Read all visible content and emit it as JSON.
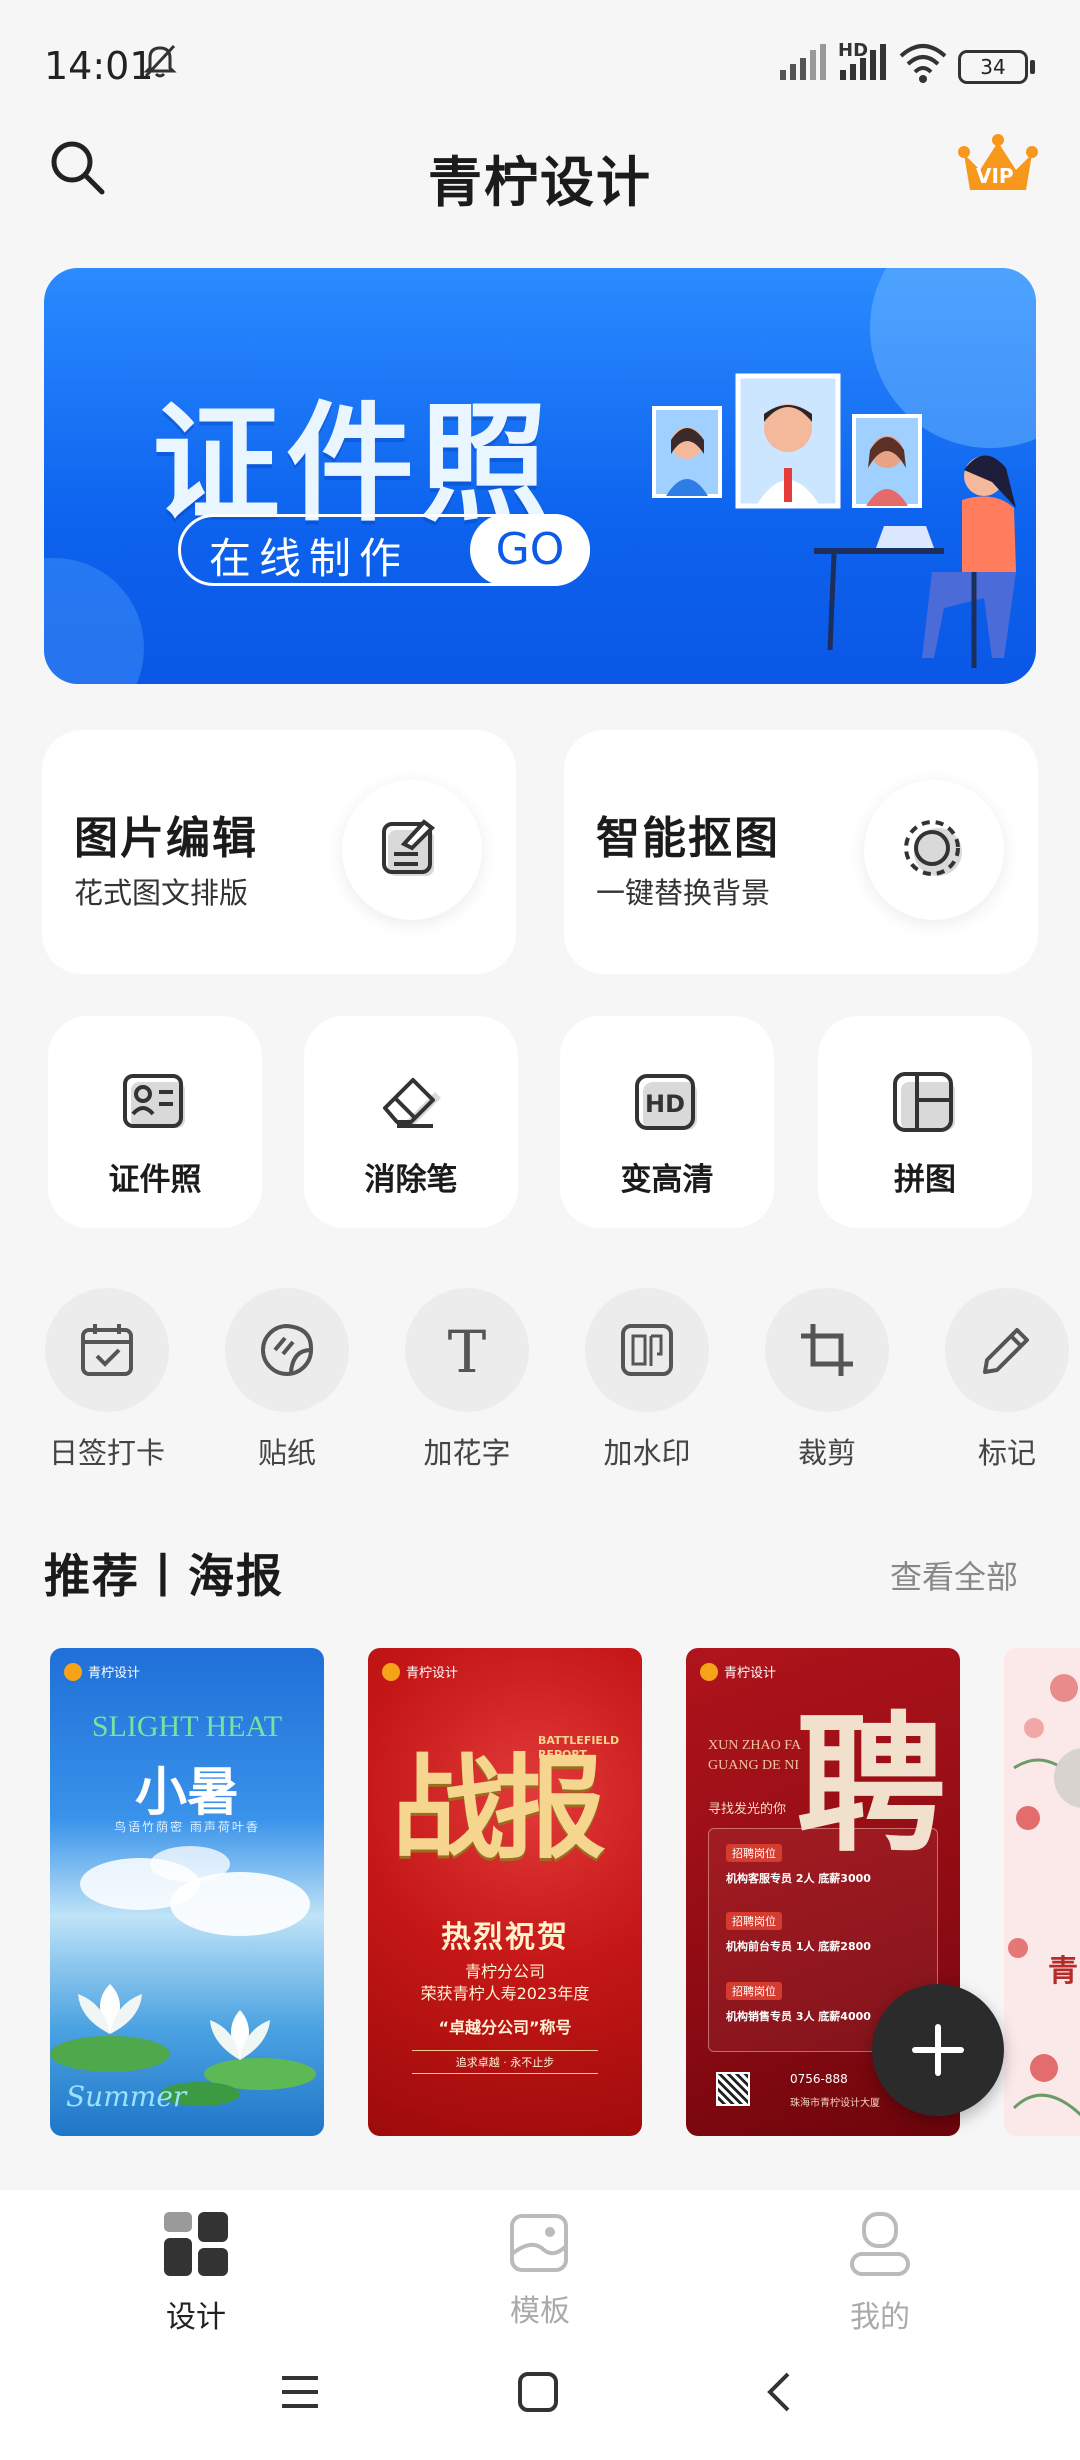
{
  "status_bar": {
    "time": "14:01",
    "mute_icon": "bell-off-icon",
    "signal_label": "HD",
    "battery": "34"
  },
  "header": {
    "title": "青柠设计",
    "search_icon": "search-icon",
    "vip_label": "VIP"
  },
  "banner": {
    "title": "证件照",
    "pill_text": "在线制作",
    "go_label": "GO"
  },
  "feature_cards": [
    {
      "title": "图片编辑",
      "subtitle": "花式图文排版",
      "icon": "edit-document-icon"
    },
    {
      "title": "智能抠图",
      "subtitle": "一键替换背景",
      "icon": "cutout-circle-icon"
    }
  ],
  "tool_cards": [
    {
      "label": "证件照",
      "icon": "id-card-icon"
    },
    {
      "label": "消除笔",
      "icon": "eraser-icon"
    },
    {
      "label": "变高清",
      "icon": "hd-icon"
    },
    {
      "label": "拼图",
      "icon": "collage-icon"
    }
  ],
  "round_tools": [
    {
      "label": "日签打卡",
      "icon": "calendar-check-icon"
    },
    {
      "label": "贴纸",
      "icon": "sticker-icon"
    },
    {
      "label": "加花字",
      "icon": "text-t-icon"
    },
    {
      "label": "加水印",
      "icon": "stamp-icon"
    },
    {
      "label": "裁剪",
      "icon": "crop-icon"
    },
    {
      "label": "标记",
      "icon": "pencil-icon"
    }
  ],
  "recommend": {
    "title": "推荐丨海报",
    "more_label": "查看全部"
  },
  "posters": [
    {
      "brand": "青柠设计",
      "heading_en": "SLIGHT HEAT",
      "heading_cn": "小暑",
      "sub": "鸟语竹荫密 雨声荷叶香",
      "script": "Summer"
    },
    {
      "brand": "青柠设计",
      "heading_cn": "战报",
      "tag": "BATTLEFIELD REPORT",
      "line1": "热烈祝贺",
      "line2": "青柠分公司",
      "line3": "荣获青柠人寿2023年度",
      "line4": "“卓越分公司”称号",
      "line5": "追求卓越 · 永不止步"
    },
    {
      "brand": "青柠设计",
      "heading_cn": "聘",
      "en": "XUN ZHAO FA GUANG DE NI",
      "sub": "寻找发光的你",
      "tag": "招聘岗位",
      "job1": "机构客服专员  2人  底薪3000",
      "job2": "机构前台专员  1人  底薪2800",
      "job3": "机构销售专员  3人  底薪4000",
      "phone": "0756-888",
      "addr": "珠海市青柠设计大厦"
    },
    {
      "text": "青"
    }
  ],
  "bottom_nav": [
    {
      "label": "设计",
      "active": true,
      "icon": "grid-design-icon"
    },
    {
      "label": "模板",
      "active": false,
      "icon": "template-icon"
    },
    {
      "label": "我的",
      "active": false,
      "icon": "user-icon"
    }
  ],
  "colors": {
    "accent": "#0d63ee",
    "text": "#1b1b1b",
    "muted": "#888888",
    "vip": "#f7971c"
  }
}
